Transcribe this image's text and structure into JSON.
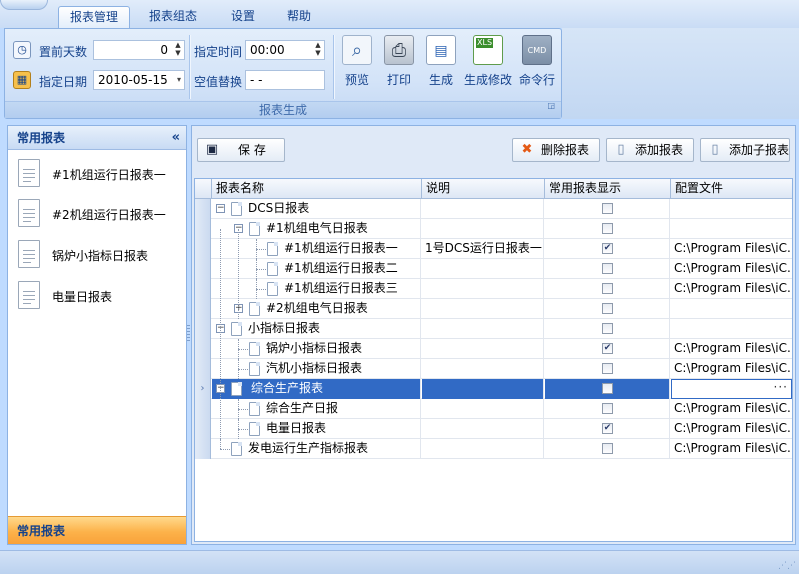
{
  "ribbon": {
    "tabs": [
      {
        "label": "报表管理",
        "active": true
      },
      {
        "label": "报表组态"
      },
      {
        "label": "设置"
      },
      {
        "label": "帮助"
      }
    ],
    "group_label": "报表生成",
    "fields": {
      "days_label": "置前天数",
      "days_value": "0",
      "date_label": "指定日期",
      "date_value": "2010-05-15",
      "time_label": "指定时间",
      "time_value": "00:00",
      "null_label": "空值替换",
      "null_value": "- -"
    },
    "buttons": [
      {
        "label": "预览",
        "icon": "preview-magnifier-icon"
      },
      {
        "label": "打印",
        "icon": "printer-icon"
      },
      {
        "label": "生成",
        "icon": "generate-doc-icon"
      },
      {
        "label": "生成修改",
        "icon": "xls-generate-icon",
        "icon_text": "XLS"
      },
      {
        "label": "命令行",
        "icon": "cmd-icon",
        "icon_text": "CMD"
      }
    ]
  },
  "left_panel": {
    "title": "常用报表",
    "collapse_glyph": "«",
    "items": [
      {
        "label": "#1机组运行日报表一"
      },
      {
        "label": "#2机组运行日报表一"
      },
      {
        "label": "锅炉小指标日报表"
      },
      {
        "label": "电量日报表"
      }
    ],
    "footer": "常用报表"
  },
  "toolbar": {
    "save_label": "保 存",
    "delete_label": "删除报表",
    "add_label": "添加报表",
    "add_child_label": "添加子报表"
  },
  "grid": {
    "columns": [
      "报表名称",
      "说明",
      "常用报表显示",
      "配置文件"
    ],
    "rows": [
      {
        "name": "DCS日报表",
        "desc": "",
        "checked": false,
        "config": ""
      },
      {
        "name": "#1机组电气日报表",
        "desc": "",
        "checked": false,
        "config": ""
      },
      {
        "name": "#1机组运行日报表一",
        "desc": "1号DCS运行日报表一",
        "checked": true,
        "config": "C:\\Program Files\\iC..."
      },
      {
        "name": "#1机组运行日报表二",
        "desc": "",
        "checked": false,
        "config": "C:\\Program Files\\iC..."
      },
      {
        "name": "#1机组运行日报表三",
        "desc": "",
        "checked": false,
        "config": "C:\\Program Files\\iC..."
      },
      {
        "name": "#2机组电气日报表",
        "desc": "",
        "checked": false,
        "config": ""
      },
      {
        "name": "小指标日报表",
        "desc": "",
        "checked": false,
        "config": ""
      },
      {
        "name": "锅炉小指标日报表",
        "desc": "",
        "checked": true,
        "config": "C:\\Program Files\\iC..."
      },
      {
        "name": "汽机小指标日报表",
        "desc": "",
        "checked": false,
        "config": "C:\\Program Files\\iC..."
      },
      {
        "name": "综合生产报表",
        "desc": "",
        "checked": false,
        "config": "",
        "selected": true,
        "ellipsis": "···"
      },
      {
        "name": "综合生产日报",
        "desc": "",
        "checked": false,
        "config": "C:\\Program Files\\iC..."
      },
      {
        "name": "电量日报表",
        "desc": "",
        "checked": true,
        "config": "C:\\Program Files\\iC..."
      },
      {
        "name": "发电运行生产指标报表",
        "desc": "",
        "checked": false,
        "config": "C:\\Program Files\\iC..."
      }
    ]
  },
  "colors": {
    "ribbon_bg": "#d3e3f8",
    "selection": "#316ac5",
    "footer_orange": "#fcb24a",
    "text_blue": "#15428b"
  }
}
